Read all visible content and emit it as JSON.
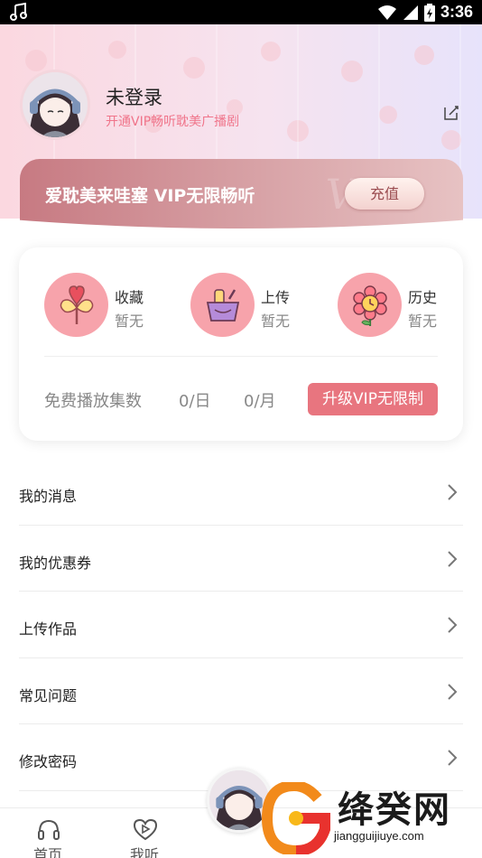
{
  "status_bar": {
    "time": "3:36",
    "icons": [
      "music-note-icon",
      "wifi-icon",
      "signal-icon",
      "battery-icon"
    ]
  },
  "profile": {
    "username": "未登录",
    "subtitle": "开通VIP畅听耽美广播剧"
  },
  "vip_banner": {
    "text": "爱耽美来哇塞 VIP无限畅听",
    "button_label": "充值",
    "watermark": "VIP"
  },
  "stats": {
    "items": [
      {
        "label": "收藏",
        "value": "暂无",
        "icon": "heart-lollipop-icon"
      },
      {
        "label": "上传",
        "value": "暂无",
        "icon": "basket-icon"
      },
      {
        "label": "历史",
        "value": "暂无",
        "icon": "flower-clock-icon"
      }
    ],
    "free_label": "免费播放集数",
    "free_day": "0/日",
    "free_month": "0/月",
    "upgrade_label": "升级VIP无限制"
  },
  "menu": {
    "items": [
      {
        "label": "我的消息"
      },
      {
        "label": "我的优惠券"
      },
      {
        "label": "上传作品"
      },
      {
        "label": "常见问题"
      },
      {
        "label": "修改密码"
      }
    ]
  },
  "bottom_nav": {
    "items": [
      {
        "label": "首页",
        "icon": "home-icon"
      },
      {
        "label": "我听",
        "icon": "play-heart-icon"
      }
    ]
  },
  "site_watermark": {
    "brand": "绛癸网",
    "url": "jiangguijiuye.com"
  },
  "colors": {
    "accent_pink": "#e8757f",
    "icon_circle": "#f7a3ab",
    "subtitle_pink": "#f0748a"
  }
}
